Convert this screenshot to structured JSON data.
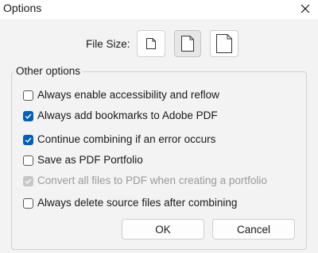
{
  "window": {
    "title": "Options",
    "close_icon": "close-icon"
  },
  "file_size": {
    "label": "File Size:",
    "buttons": [
      {
        "name": "smaller-file-size",
        "icon": "small-page-icon",
        "selected": false
      },
      {
        "name": "default-file-size",
        "icon": "medium-page-icon",
        "selected": true
      },
      {
        "name": "larger-file-size",
        "icon": "large-page-icon",
        "selected": false
      }
    ]
  },
  "other_options": {
    "legend": "Other options",
    "options": [
      {
        "label": "Always enable accessibility and reflow",
        "checked": false,
        "enabled": true
      },
      {
        "label": "Always add bookmarks to Adobe PDF",
        "checked": true,
        "enabled": true
      },
      {
        "label": "Continue combining if an error occurs",
        "checked": true,
        "enabled": true
      },
      {
        "label": "Save as PDF Portfolio",
        "checked": false,
        "enabled": true
      },
      {
        "label": "Convert all files to PDF when creating a portfolio",
        "checked": true,
        "enabled": false
      },
      {
        "label": "Always delete source files after combining",
        "checked": false,
        "enabled": true
      }
    ]
  },
  "buttons": {
    "ok_label": "OK",
    "cancel_label": "Cancel"
  },
  "colors": {
    "accent": "#005fb8",
    "disabled": "#c6c6c6"
  }
}
